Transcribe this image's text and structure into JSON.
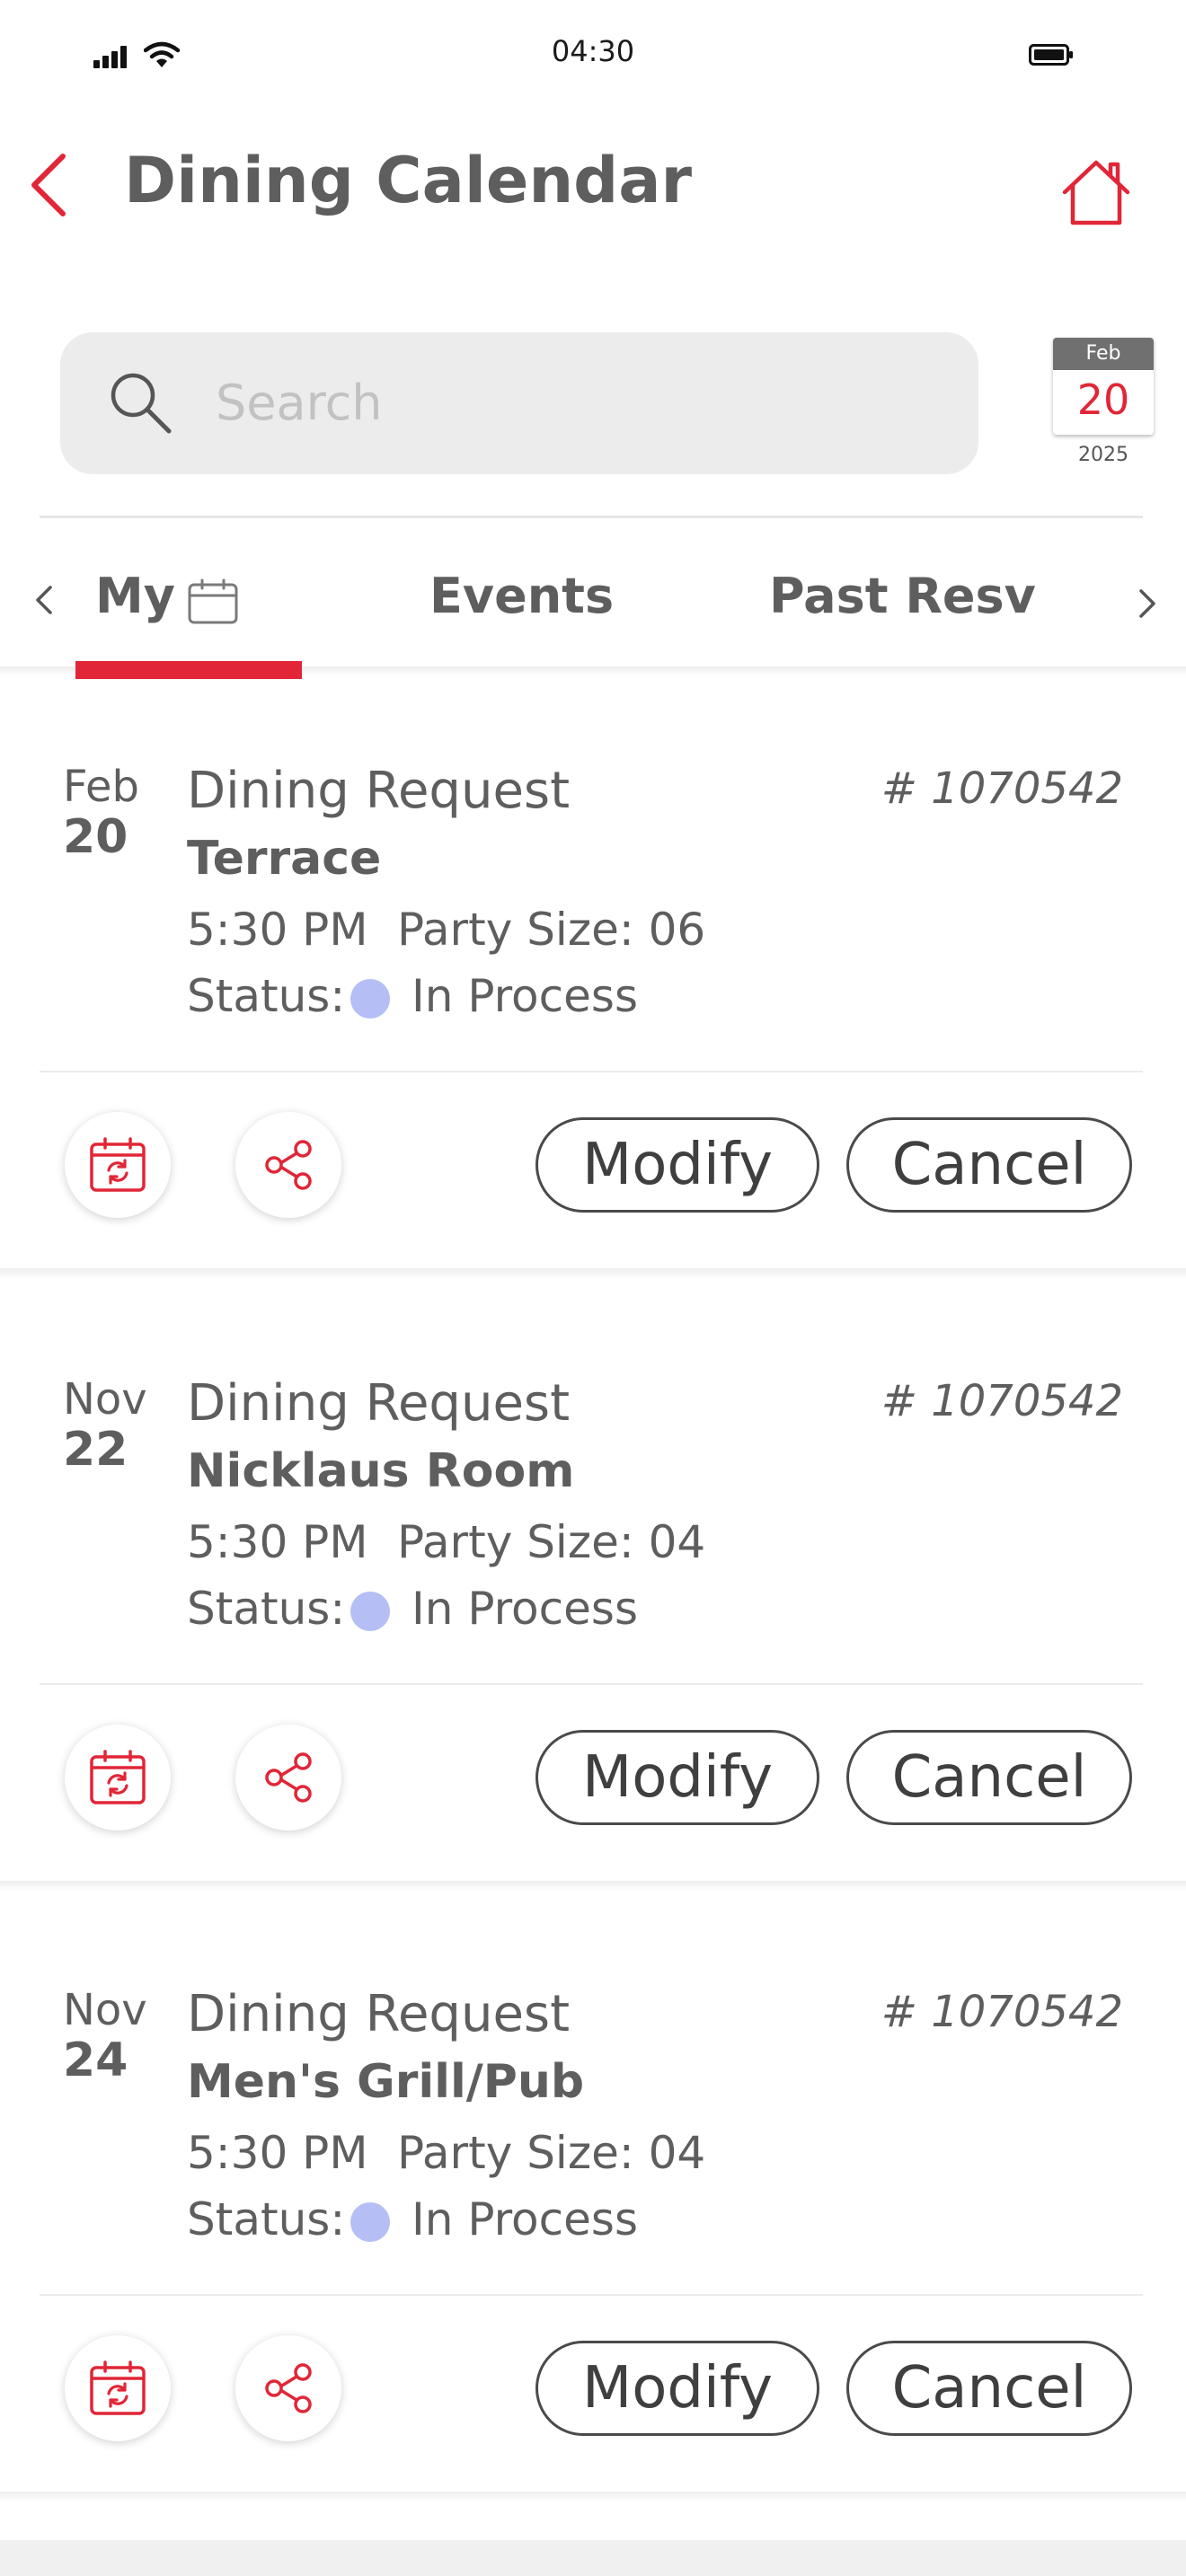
{
  "status_bar": {
    "time": "04:30"
  },
  "header": {
    "title": "Dining Calendar"
  },
  "search": {
    "placeholder": "Search"
  },
  "date_badge": {
    "month": "Feb",
    "day": "20",
    "year": "2025"
  },
  "tabs": [
    {
      "label": "My",
      "active": true
    },
    {
      "label": "Events",
      "active": false
    },
    {
      "label": "Past Resv",
      "active": false
    }
  ],
  "reservations": [
    {
      "month": "Feb",
      "day": "20",
      "type": "Dining Request",
      "ref": "# 1070542",
      "venue": "Terrace",
      "time": "5:30 PM",
      "party": "Party Size: 06",
      "status_label": "Status:",
      "status": "In Process"
    },
    {
      "month": "Nov",
      "day": "22",
      "type": "Dining Request",
      "ref": "# 1070542",
      "venue": "Nicklaus Room",
      "time": "5:30 PM",
      "party": "Party Size: 04",
      "status_label": "Status:",
      "status": "In Process"
    },
    {
      "month": "Nov",
      "day": "24",
      "type": "Dining Request",
      "ref": "# 1070542",
      "venue": "Men's Grill/Pub",
      "time": "5:30 PM",
      "party": "Party Size: 04",
      "status_label": "Status:",
      "status": "In Process"
    }
  ],
  "actions": {
    "modify_label": "Modify",
    "cancel_label": "Cancel"
  },
  "icons": {
    "back": "chevron-left-icon",
    "home": "home-icon",
    "search": "search-icon",
    "tab_calendar": "calendar-icon",
    "add_to_calendar": "calendar-sync-icon",
    "share": "share-icon"
  },
  "colors": {
    "accent": "#e12637",
    "status_in_process": "#b5bff5",
    "search_bg": "#ececec",
    "text": "#5e5e5e"
  }
}
